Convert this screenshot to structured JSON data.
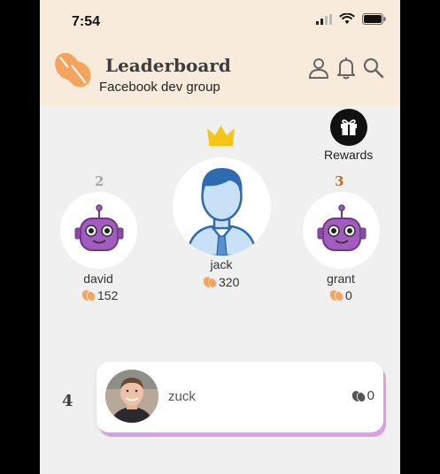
{
  "status": {
    "time": "7:54"
  },
  "header": {
    "title": "Leaderboard",
    "subtitle": "Facebook dev group"
  },
  "rewards": {
    "label": "Rewards"
  },
  "podium": [
    {
      "rank": "2",
      "name": "david",
      "score": "152"
    },
    {
      "rank": "",
      "name": "jack",
      "score": "320"
    },
    {
      "rank": "3",
      "name": "grant",
      "score": "0"
    }
  ],
  "list": [
    {
      "rank": "4",
      "name": "zuck",
      "score": "0"
    }
  ],
  "colors": {
    "header_bg": "#f8ebdb",
    "body_bg": "#f1f0f0",
    "accent_orange": "#f5a45d",
    "crown_gold": "#f5c518",
    "rank2_gray": "#a6a6a6",
    "rank3_bronze": "#b86e2c",
    "robot_purple": "#a35bc1",
    "card_shadow": "#d9a0e4"
  }
}
